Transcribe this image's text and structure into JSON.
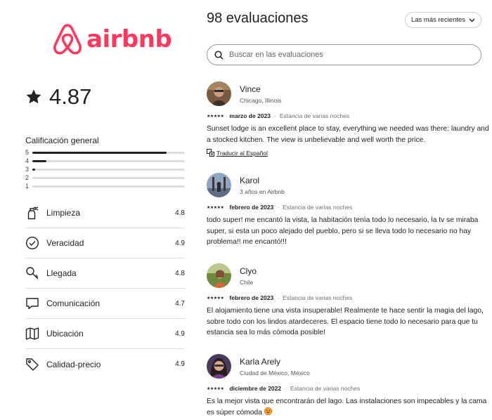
{
  "brand": {
    "name": "airbnb",
    "color": "#FF385C"
  },
  "summary": {
    "rating": "4.87",
    "overall_label": "Calificación general",
    "distribution": [
      {
        "label": "5",
        "fraction": 0.88
      },
      {
        "label": "4",
        "fraction": 0.09
      },
      {
        "label": "3",
        "fraction": 0.02
      },
      {
        "label": "2",
        "fraction": 0.0
      },
      {
        "label": "1",
        "fraction": 0.0
      }
    ],
    "categories": [
      {
        "name": "Limpieza",
        "score": "4.8",
        "icon": "spray-bottle-icon"
      },
      {
        "name": "Veracidad",
        "score": "4.9",
        "icon": "check-circle-icon"
      },
      {
        "name": "Llegada",
        "score": "4.8",
        "icon": "key-icon"
      },
      {
        "name": "Comunicación",
        "score": "4.7",
        "icon": "chat-bubble-icon"
      },
      {
        "name": "Ubicación",
        "score": "4.9",
        "icon": "map-icon"
      },
      {
        "name": "Calidad-precio",
        "score": "4.9",
        "icon": "tag-icon"
      }
    ]
  },
  "header": {
    "title": "98 evaluaciones",
    "sort_label": "Las más recientes",
    "search_placeholder": "Buscar en las evaluaciones"
  },
  "reviews": [
    {
      "name": "Vince",
      "location": "Chicago, Illinois",
      "stars": "★★★★★",
      "date": "marzo de 2023",
      "stay": "Estancia de varias noches",
      "text": "Sunset lodge is an excellent place to stay, everything we needed was there: laundry and a stocked kitchen. The view is unbelievable and well worth the price.",
      "translate": "Traducir al Español"
    },
    {
      "name": "Karol",
      "location": "3 años en Airbnb",
      "stars": "★★★★★",
      "date": "febrero de 2023",
      "stay": "Estancia de varias noches",
      "text": "todo super! me encantó la vista, la habitación tenía todo lo necesario, la tv se miraba super, si esta un poco alejado del pueblo, pero si se lleva todo lo necesario no hay problema!! me encantó!!!"
    },
    {
      "name": "Clyo",
      "location": "Chile",
      "stars": "★★★★★",
      "date": "febrero de 2023",
      "stay": "Estancia de varias noches",
      "text": "El alojamiento tiene una vista insuperable! Realmente te hace sentir la magia del lago, sobre todo con los lindos atardeceres. El espacio tiene todo lo necesario para que tu estancia sea lo más cómoda posible!"
    },
    {
      "name": "Karla Arely",
      "location": "Ciudad de México, México",
      "stars": "★★★★★",
      "date": "diciembre de 2022",
      "stay": "Estancia de varias noches",
      "text": "Es la mejor vista que encontrarán del lago. Las instalaciones son impecables y la cama es súper cómoda"
    }
  ]
}
